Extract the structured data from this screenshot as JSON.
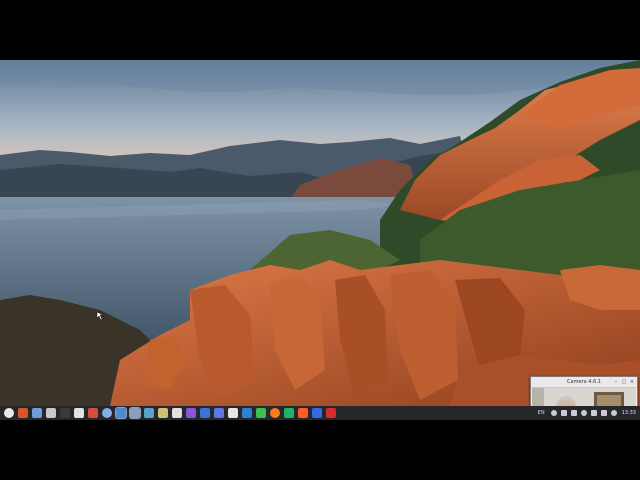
{
  "camera_window": {
    "title": "Camera 4.6.1",
    "minimize_label": "–",
    "maximize_label": "□",
    "close_label": "×"
  },
  "taskbar": {
    "launchers": [
      {
        "name": "menu-icon",
        "color": "#e9e9e9"
      },
      {
        "name": "xfce-icon",
        "color": "#d9532b"
      },
      {
        "name": "files-icon",
        "color": "#6e9ed6"
      },
      {
        "name": "text-editor-icon",
        "color": "#c9c9c9"
      },
      {
        "name": "terminal-icon",
        "color": "#3a3a3a"
      },
      {
        "name": "file-manager-icon",
        "color": "#e2e2e2"
      },
      {
        "name": "settings-icon",
        "color": "#d64d3c"
      },
      {
        "name": "globe-icon",
        "color": "#7fb0e6"
      },
      {
        "name": "display-icon",
        "color": "#4b8bd0"
      },
      {
        "name": "window-icon",
        "color": "#8aa0b8"
      },
      {
        "name": "app-grid-icon",
        "color": "#5aa0c8"
      },
      {
        "name": "notes-icon",
        "color": "#d0c070"
      },
      {
        "name": "media-icon",
        "color": "#e0e0e0"
      },
      {
        "name": "purple-app-icon",
        "color": "#8b53d6"
      },
      {
        "name": "blue-app-icon",
        "color": "#3a74d8"
      },
      {
        "name": "shield-icon",
        "color": "#5f76e6"
      },
      {
        "name": "git-icon",
        "color": "#e6e6e6"
      },
      {
        "name": "code-editor-icon",
        "color": "#2c82d8"
      },
      {
        "name": "qt-icon",
        "color": "#3fbe4d"
      },
      {
        "name": "firefox-icon",
        "color": "#ff7a1e"
      },
      {
        "name": "vpn-icon",
        "color": "#1fb46a"
      },
      {
        "name": "brave-icon",
        "color": "#ff5a2a"
      },
      {
        "name": "proton-icon",
        "color": "#3b66e6"
      },
      {
        "name": "filezilla-icon",
        "color": "#d62b2b"
      }
    ],
    "tray_language": "EN",
    "tray_icons": [
      "sound-icon",
      "bell-icon",
      "network-icon",
      "bluetooth-icon",
      "battery-icon",
      "keyboard-icon",
      "power-icon"
    ],
    "clock": "13:33"
  },
  "colors": {
    "taskbar_bg": "#26272b",
    "sky_top": "#5e7d99",
    "sea": "#5b7086",
    "rock": "#c25a2e"
  }
}
